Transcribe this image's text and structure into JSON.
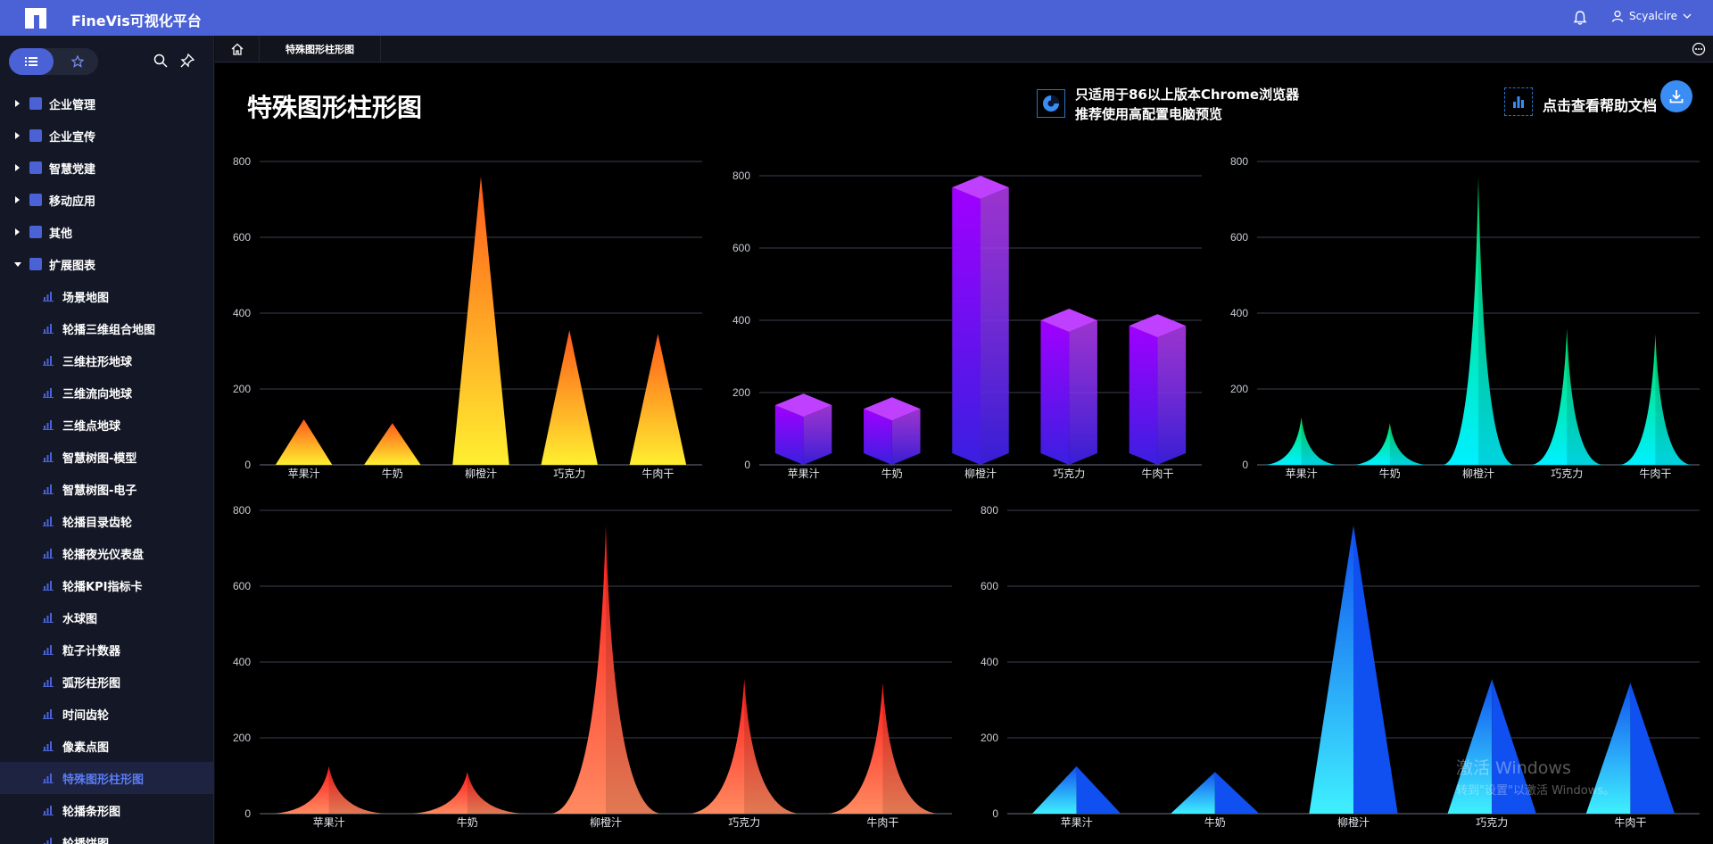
{
  "app": {
    "title": "FineVis可视化平台",
    "user": "Scyalcire"
  },
  "sidebar": {
    "categories": [
      {
        "label": "企业管理",
        "open": false
      },
      {
        "label": "企业宣传",
        "open": false
      },
      {
        "label": "智慧党建",
        "open": false
      },
      {
        "label": "移动应用",
        "open": false
      },
      {
        "label": "其他",
        "open": false
      },
      {
        "label": "扩展图表",
        "open": true
      }
    ],
    "items": [
      "场景地图",
      "轮播三维组合地图",
      "三维柱形地球",
      "三维流向地球",
      "三维点地球",
      "智慧树图-模型",
      "智慧树图-电子",
      "轮播目录齿轮",
      "轮播夜光仪表盘",
      "轮播KPI指标卡",
      "水球图",
      "粒子计数器",
      "弧形柱形图",
      "时间齿轮",
      "像素点图",
      "特殊图形柱形图",
      "轮播条形图",
      "轮播饼图"
    ],
    "active_item": "特殊图形柱形图"
  },
  "tabs": {
    "current": "特殊图形柱形图"
  },
  "page": {
    "title": "特殊图形柱形图",
    "notice_line1": "只适用于86以上版本Chrome浏览器",
    "notice_line2": "推荐使用高配置电脑预览",
    "help_text": "点击查看帮助文档"
  },
  "watermark": {
    "line1": "激活 Windows",
    "line2": "转到\"设置\"以激活 Windows。"
  },
  "colors": {
    "accent": "#4a62d6",
    "grid": "#3a4050"
  },
  "chart_data": [
    {
      "type": "bar",
      "style": "triangle",
      "categories": [
        "苹果汁",
        "牛奶",
        "柳橙汁",
        "巧克力",
        "牛肉干"
      ],
      "values": [
        120,
        110,
        760,
        355,
        345
      ],
      "ylim": [
        0,
        800
      ],
      "yticks": [
        0,
        200,
        400,
        600,
        800
      ],
      "colors": [
        "#ffef30",
        "#ff5a1a"
      ]
    },
    {
      "type": "bar",
      "style": "cube",
      "categories": [
        "苹果汁",
        "牛奶",
        "柳橙汁",
        "巧克力",
        "牛肉干"
      ],
      "values": [
        165,
        155,
        800,
        400,
        385
      ],
      "ylim": [
        0,
        800
      ],
      "yticks": [
        0,
        200,
        400,
        600,
        800
      ],
      "colors": [
        "#3a1fe0",
        "#a000ff",
        "#c040ff"
      ]
    },
    {
      "type": "bar",
      "style": "peak",
      "categories": [
        "苹果汁",
        "牛奶",
        "柳橙汁",
        "巧克力",
        "牛肉干"
      ],
      "values": [
        125,
        110,
        760,
        360,
        345
      ],
      "ylim": [
        0,
        800
      ],
      "yticks": [
        0,
        200,
        400,
        600,
        800
      ],
      "colors": [
        "#00f0ff",
        "#00e060"
      ]
    },
    {
      "type": "bar",
      "style": "peak",
      "categories": [
        "苹果汁",
        "牛奶",
        "柳橙汁",
        "巧克力",
        "牛肉干"
      ],
      "values": [
        125,
        110,
        760,
        355,
        345
      ],
      "ylim": [
        0,
        800
      ],
      "yticks": [
        0,
        200,
        400,
        600,
        800
      ],
      "colors": [
        "#ff8a60",
        "#ff1a1a"
      ]
    },
    {
      "type": "bar",
      "style": "pyramid",
      "categories": [
        "苹果汁",
        "牛奶",
        "柳橙汁",
        "巧克力",
        "牛肉干"
      ],
      "values": [
        125,
        110,
        760,
        355,
        345
      ],
      "ylim": [
        0,
        800
      ],
      "yticks": [
        0,
        200,
        400,
        600,
        800
      ],
      "colors": [
        "#3ff0ff",
        "#1050f0"
      ]
    }
  ]
}
